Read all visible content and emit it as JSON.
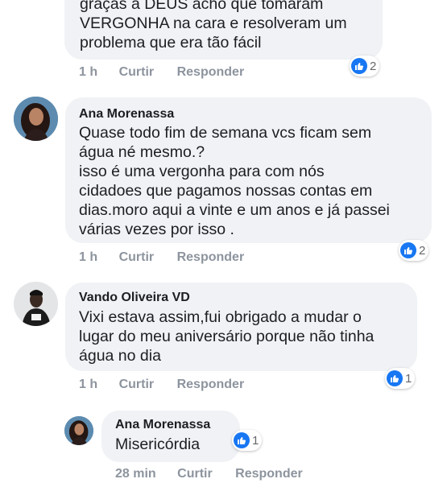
{
  "comments": [
    {
      "lines": [
        "graças a DEUS acho que tomaram",
        "VERGONHA na cara e resolveram um",
        "problema que era tão fácil"
      ],
      "time": "1 h",
      "like_label": "Curtir",
      "reply_label": "Responder",
      "reaction_count": "2"
    },
    {
      "author": "Ana Morenassa",
      "lines": [
        "Quase todo fim de semana vcs ficam sem",
        "água né mesmo.?",
        "isso é uma vergonha para com nós",
        "cidadoes que pagamos nossas contas em",
        "dias.moro aqui a vinte e um anos e já passei",
        "várias vezes por isso ."
      ],
      "time": "1 h",
      "like_label": "Curtir",
      "reply_label": "Responder",
      "reaction_count": "2"
    },
    {
      "author": "Vando Oliveira VD",
      "lines": [
        "Vixi estava assim,fui obrigado a mudar o",
        "lugar do meu aniversário porque não tinha",
        "água no dia"
      ],
      "time": "1 h",
      "like_label": "Curtir",
      "reply_label": "Responder",
      "reaction_count": "1"
    },
    {
      "author": "Ana Morenassa",
      "lines": [
        "Misericórdia"
      ],
      "time": "28 min",
      "like_label": "Curtir",
      "reply_label": "Responder",
      "reaction_count": "1"
    }
  ],
  "icons": {
    "reaction": "like-icon"
  },
  "colors": {
    "like": "#1877f2",
    "bubble": "#f0f2f5",
    "meta": "#8d949e"
  }
}
